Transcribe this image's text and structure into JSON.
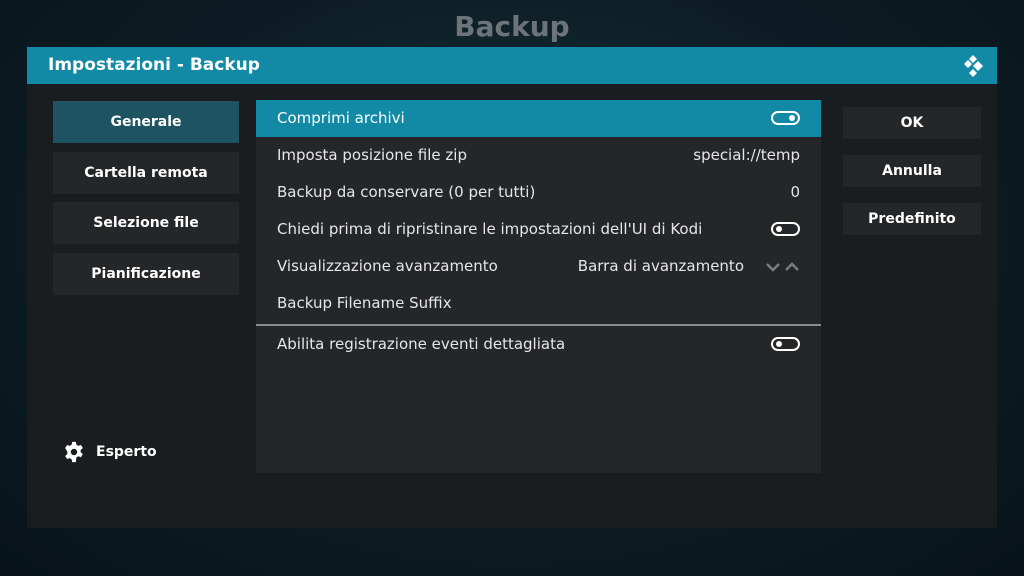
{
  "page": {
    "title": "Backup"
  },
  "dialog": {
    "title": "Impostazioni - Backup",
    "logo_icon": "kodi-logo-icon"
  },
  "sidebar": {
    "items": [
      {
        "label": "Generale",
        "selected": true
      },
      {
        "label": "Cartella remota",
        "selected": false
      },
      {
        "label": "Selezione file",
        "selected": false
      },
      {
        "label": "Pianificazione",
        "selected": false
      }
    ],
    "level": {
      "label": "Esperto",
      "icon": "gear-icon"
    }
  },
  "settings": [
    {
      "label": "Comprimi archivi",
      "type": "toggle",
      "on": true,
      "focused": true
    },
    {
      "label": "Imposta posizione file zip",
      "type": "value",
      "value": "special://temp"
    },
    {
      "label": "Backup da conservare (0 per tutti)",
      "type": "value",
      "value": "0"
    },
    {
      "label": "Chiedi prima di ripristinare le impostazioni dell'UI di Kodi",
      "type": "toggle",
      "on": false
    },
    {
      "label": "Visualizzazione avanzamento",
      "type": "spinner",
      "value": "Barra di avanzamento",
      "spinner_icon": "chevron-up-down-icon"
    },
    {
      "label": "Backup Filename Suffix",
      "type": "value",
      "value": ""
    },
    {
      "label": "Abilita registrazione eventi dettagliata",
      "type": "toggle",
      "on": false
    }
  ],
  "buttons": {
    "ok": "OK",
    "cancel": "Annulla",
    "default": "Predefinito"
  },
  "colors": {
    "accent": "#128aa6",
    "selected_tab": "#1e5462",
    "panel": "#242628",
    "dialog_bg": "#1a1d1f",
    "page_title": "#6c7479"
  }
}
